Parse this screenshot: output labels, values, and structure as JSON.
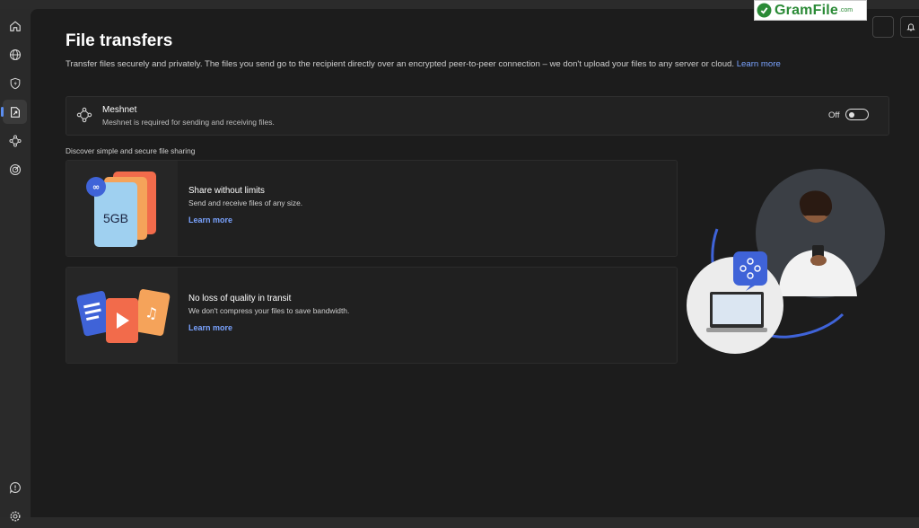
{
  "page": {
    "title": "File transfers",
    "subtitle": "Transfer files securely and privately. The files you send go to the recipient directly over an encrypted peer-to-peer connection – we don't upload your files to any server or cloud.",
    "learn_more": "Learn more"
  },
  "meshnet": {
    "title": "Meshnet",
    "description": "Meshnet is required for sending and receiving files.",
    "state": "Off"
  },
  "discover": {
    "heading": "Discover simple and secure file sharing",
    "cards": [
      {
        "title": "Share without limits",
        "description": "Send and receive files of any size.",
        "link": "Learn more",
        "badge": "5GB"
      },
      {
        "title": "No loss of quality in transit",
        "description": "We don't compress your files to save bandwidth.",
        "link": "Learn more"
      }
    ]
  },
  "sidebar": {
    "items": [
      {
        "icon": "home-icon"
      },
      {
        "icon": "globe-icon"
      },
      {
        "icon": "shield-icon"
      },
      {
        "icon": "file-transfer-icon",
        "active": true
      },
      {
        "icon": "meshnet-icon"
      },
      {
        "icon": "target-icon"
      }
    ],
    "bottom": [
      {
        "icon": "help-icon"
      },
      {
        "icon": "settings-icon"
      }
    ]
  },
  "watermark": {
    "text": "GramFile",
    "suffix": ".com"
  },
  "colors": {
    "accent": "#5b8def",
    "link": "#7aa3ff",
    "background": "#1c1c1c",
    "card": "#202020"
  }
}
